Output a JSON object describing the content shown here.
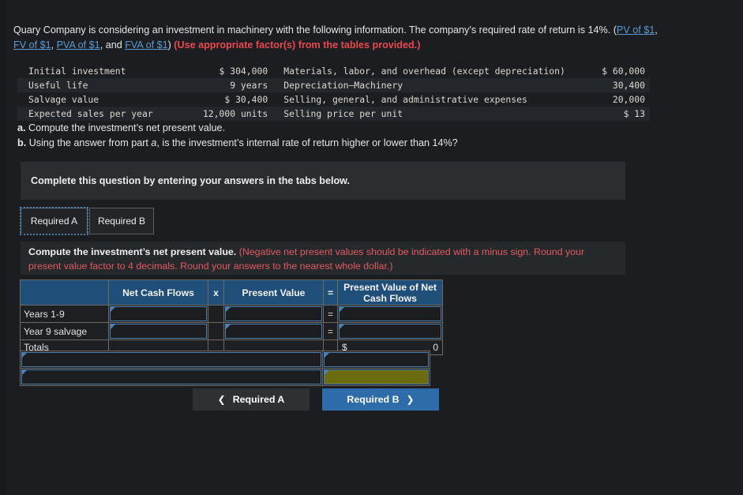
{
  "statement": {
    "line1_part1": "Quary Company is considering an investment in machinery with the following information. The company’s required rate of return is 14%. (",
    "links": [
      "PV of $1",
      "FV of $1",
      "PVA of $1",
      "FVA of $1"
    ],
    "sep1": ", ",
    "sep2": ", ",
    "sep3": ", and ",
    "close": ") ",
    "red_note": "(Use appropriate factor(s) from the tables provided.)"
  },
  "given_table": {
    "rows": [
      {
        "label": "Initial investment",
        "value": "$ 304,000",
        "label2": "Materials, labor, and overhead (except depreciation)",
        "value2": "$ 60,000"
      },
      {
        "label": "Useful life",
        "value": "9 years",
        "label2": "Depreciation–Machinery",
        "value2": "30,400"
      },
      {
        "label": "Salvage value",
        "value": "$ 30,400",
        "label2": "Selling, general, and administrative expenses",
        "value2": "20,000"
      },
      {
        "label": "Expected sales per year",
        "value": "12,000 units",
        "label2": "Selling price per unit",
        "value2": "$ 13"
      }
    ]
  },
  "questions": [
    {
      "marker": "a.",
      "text": "Compute the investment’s net present value."
    },
    {
      "marker": "b.",
      "pre": "Using the answer from part ",
      "em": "a",
      "post": ", is the investment’s internal rate of return higher or lower than 14%?"
    }
  ],
  "banner": {
    "text": "Complete this question by entering your answers in the tabs below."
  },
  "tabs": [
    {
      "label": "Required A",
      "active": true
    },
    {
      "label": "Required B",
      "active": false
    }
  ],
  "sub_instruction": {
    "bold": "Compute the investment’s net present value.",
    "hint": "(Negative net present values should be indicated with a minus sign. Round your present value factor to 4 decimals. Round your answers to the nearest whole dollar.)"
  },
  "answer_grid": {
    "headers": [
      "",
      "Net Cash Flows",
      "x",
      "Present Value",
      "=",
      "Present Value of Net Cash Flows"
    ],
    "rows": [
      {
        "label": "Years 1-9",
        "net_cash_flows": "",
        "op1": "",
        "present_value": "",
        "op2": "=",
        "pv_net": ""
      },
      {
        "label": "Year 9 salvage",
        "net_cash_flows": "",
        "op1": "",
        "present_value": "",
        "op2": "=",
        "pv_net": ""
      }
    ],
    "totals": {
      "label": "Totals",
      "dollar": "$",
      "value": "0"
    },
    "extra_rows": [
      {
        "left": "",
        "right": "",
        "highlight": false
      },
      {
        "left": "",
        "right": "",
        "highlight": true
      }
    ]
  },
  "nav": {
    "prev_label": "Required A",
    "prev_icon": "chevron-left-icon",
    "next_label": "Required B",
    "next_icon": "chevron-right-icon"
  },
  "colors": {
    "page_bg": "#1b1d20",
    "header_blue": "#1f4e79",
    "link_blue": "#5b9bd5",
    "hint_red": "#e05a60",
    "accent_red": "#e8494f",
    "input_border": "#4a7fae",
    "olive_cell": "#6b6b10",
    "next_button": "#2d6ca8"
  }
}
